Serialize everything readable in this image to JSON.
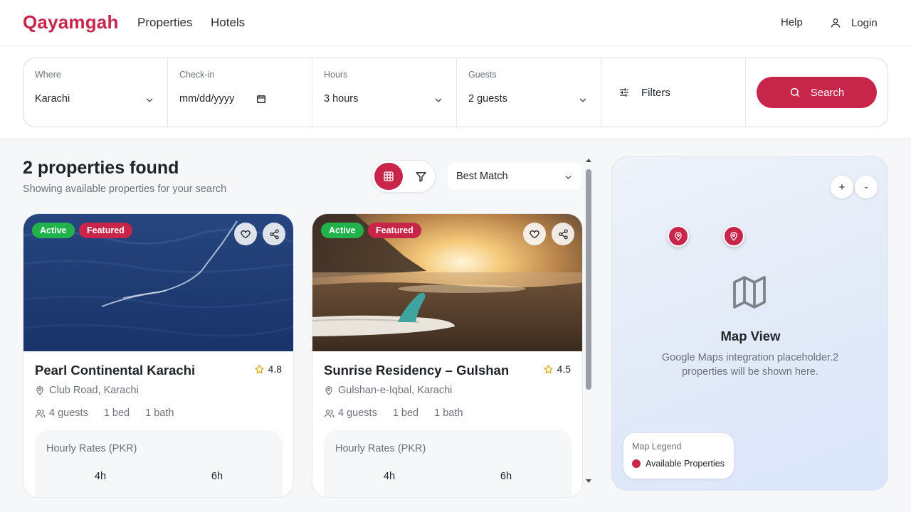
{
  "header": {
    "logo": "Qayamgah",
    "nav": [
      "Properties",
      "Hotels"
    ],
    "help": "Help",
    "login": "Login"
  },
  "search": {
    "where_label": "Where",
    "where_value": "Karachi",
    "checkin_label": "Check-in",
    "checkin_value": "mm/dd/yyyy",
    "hours_label": "Hours",
    "hours_value": "3 hours",
    "guests_label": "Guests",
    "guests_value": "2 guests",
    "filters_label": "Filters",
    "search_label": "Search"
  },
  "results": {
    "title": "2 properties found",
    "subtitle": "Showing available properties for your search",
    "sort_value": "Best Match"
  },
  "cards": [
    {
      "status": "Active",
      "featured": "Featured",
      "title": "Pearl Continental Karachi",
      "rating": "4.8",
      "location": "Club Road, Karachi",
      "guests": "4 guests",
      "beds": "1 bed",
      "baths": "1 bath",
      "rates_title": "Hourly Rates (PKR)",
      "rate_hours": [
        "4h",
        "6h"
      ]
    },
    {
      "status": "Active",
      "featured": "Featured",
      "title": "Sunrise Residency – Gulshan",
      "rating": "4.5",
      "location": "Gulshan-e-Iqbal, Karachi",
      "guests": "4 guests",
      "beds": "1 bed",
      "baths": "1 bath",
      "rates_title": "Hourly Rates (PKR)",
      "rate_hours": [
        "4h",
        "6h"
      ]
    }
  ],
  "map": {
    "zoom_in": "+",
    "zoom_out": "-",
    "title": "Map View",
    "description": "Google Maps integration placeholder.2 properties will be shown here.",
    "legend_title": "Map Legend",
    "legend_item": "Available Properties"
  },
  "colors": {
    "brand": "#c8254b",
    "active": "#22b24c"
  }
}
